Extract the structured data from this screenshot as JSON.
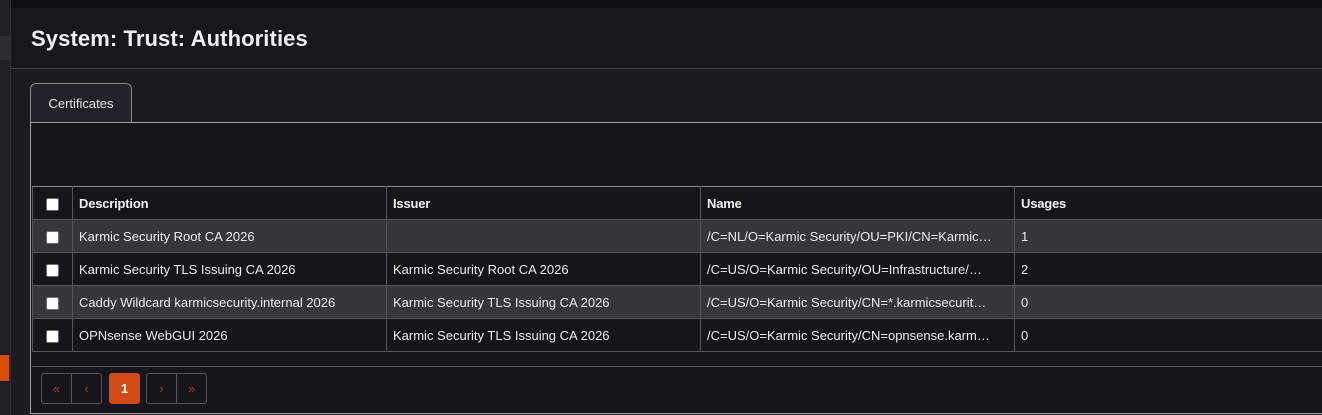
{
  "page": {
    "title": "System: Trust: Authorities"
  },
  "tabs": [
    {
      "label": "Certificates"
    }
  ],
  "table": {
    "columns": [
      "Description",
      "Issuer",
      "Name",
      "Usages"
    ],
    "rows": [
      {
        "description": "Karmic Security Root CA 2026",
        "issuer": "",
        "name": "/C=NL/O=Karmic Security/OU=PKI/CN=Karmic…",
        "usages": "1"
      },
      {
        "description": "Karmic Security TLS Issuing CA 2026",
        "issuer": "Karmic Security Root CA 2026",
        "name": "/C=US/O=Karmic Security/OU=Infrastructure/…",
        "usages": "2"
      },
      {
        "description": "Caddy Wildcard karmicsecurity.internal 2026",
        "issuer": "Karmic Security TLS Issuing CA 2026",
        "name": "/C=US/O=Karmic Security/CN=*.karmicsecurit…",
        "usages": "0"
      },
      {
        "description": "OPNsense WebGUI 2026",
        "issuer": "Karmic Security TLS Issuing CA 2026",
        "name": "/C=US/O=Karmic Security/CN=opnsense.karm…",
        "usages": "0"
      }
    ]
  },
  "pagination": {
    "first": "«",
    "prev": "‹",
    "current": "1",
    "next": "›",
    "last": "»"
  },
  "colors": {
    "accent": "#d24a16",
    "background": "#1b1b22",
    "row_stripe": "#36363b"
  }
}
